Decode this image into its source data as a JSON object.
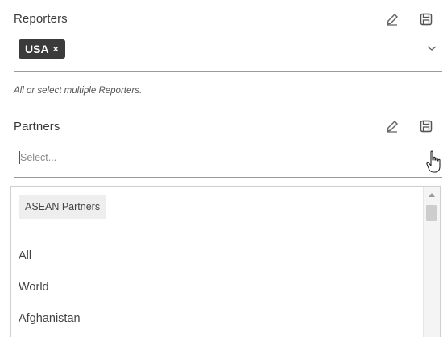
{
  "reporters": {
    "title": "Reporters",
    "selected_chip": "USA",
    "chip_remove_glyph": "×",
    "hint": "All or select multiple Reporters.",
    "icons": [
      "pencil-icon",
      "save-icon",
      "chevron-down-icon"
    ]
  },
  "partners": {
    "title": "Partners",
    "placeholder": "Select...",
    "icons": [
      "pencil-icon",
      "save-icon"
    ]
  },
  "dropdown": {
    "group_chip": "ASEAN Partners",
    "options": [
      "All",
      "World",
      "Afghanistan"
    ]
  },
  "colors": {
    "chip_bg": "#3b3b3b",
    "chip_text": "#ffffff",
    "underline": "#9a9a9a"
  }
}
